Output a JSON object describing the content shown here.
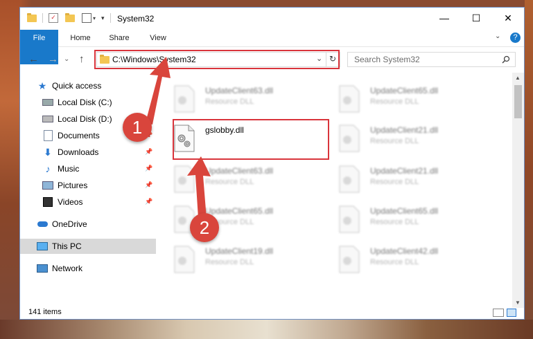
{
  "window": {
    "title": "System32"
  },
  "ribbon": {
    "tabs": [
      "File",
      "Home",
      "Share",
      "View"
    ]
  },
  "address": {
    "path": "C:\\Windows\\System32"
  },
  "search": {
    "placeholder": "Search System32"
  },
  "sidebar": {
    "items": [
      {
        "label": "Quick access",
        "icon": "star-icon"
      },
      {
        "label": "Local Disk (C:)",
        "icon": "drive-icon"
      },
      {
        "label": "Local Disk (D:)",
        "icon": "drive-icon"
      },
      {
        "label": "Documents",
        "icon": "documents-icon"
      },
      {
        "label": "Downloads",
        "icon": "download-icon"
      },
      {
        "label": "Music",
        "icon": "music-icon"
      },
      {
        "label": "Pictures",
        "icon": "pictures-icon"
      },
      {
        "label": "Videos",
        "icon": "videos-icon"
      },
      {
        "label": "OneDrive",
        "icon": "cloud-icon"
      },
      {
        "label": "This PC",
        "icon": "computer-icon"
      },
      {
        "label": "Network",
        "icon": "network-icon"
      }
    ]
  },
  "files": {
    "highlighted": {
      "name": "gslobby.dll"
    },
    "blurred": [
      {
        "name": "UpdateClient63.dll",
        "type": "Resource DLL"
      },
      {
        "name": "UpdateClient65.dll",
        "type": "Resource DLL"
      },
      {
        "name": "UpdateClient21.dll",
        "type": "Resource DLL"
      },
      {
        "name": "UpdateClient63.dll",
        "type": "Resource DLL"
      },
      {
        "name": "UpdateClient21.dll",
        "type": "Resource DLL"
      },
      {
        "name": "UpdateClient65.dll",
        "type": "Resource DLL"
      },
      {
        "name": "UpdateClient65.dll",
        "type": "Resource DLL"
      },
      {
        "name": "UpdateClient19.dll",
        "type": "Resource DLL"
      },
      {
        "name": "UpdateClient42.dll",
        "type": "Resource DLL"
      }
    ]
  },
  "status": {
    "count": "141 items"
  },
  "annotations": {
    "one": "1",
    "two": "2"
  },
  "colors": {
    "accent": "#1979ca",
    "highlight": "#d9343b",
    "badge": "#d9453c"
  }
}
